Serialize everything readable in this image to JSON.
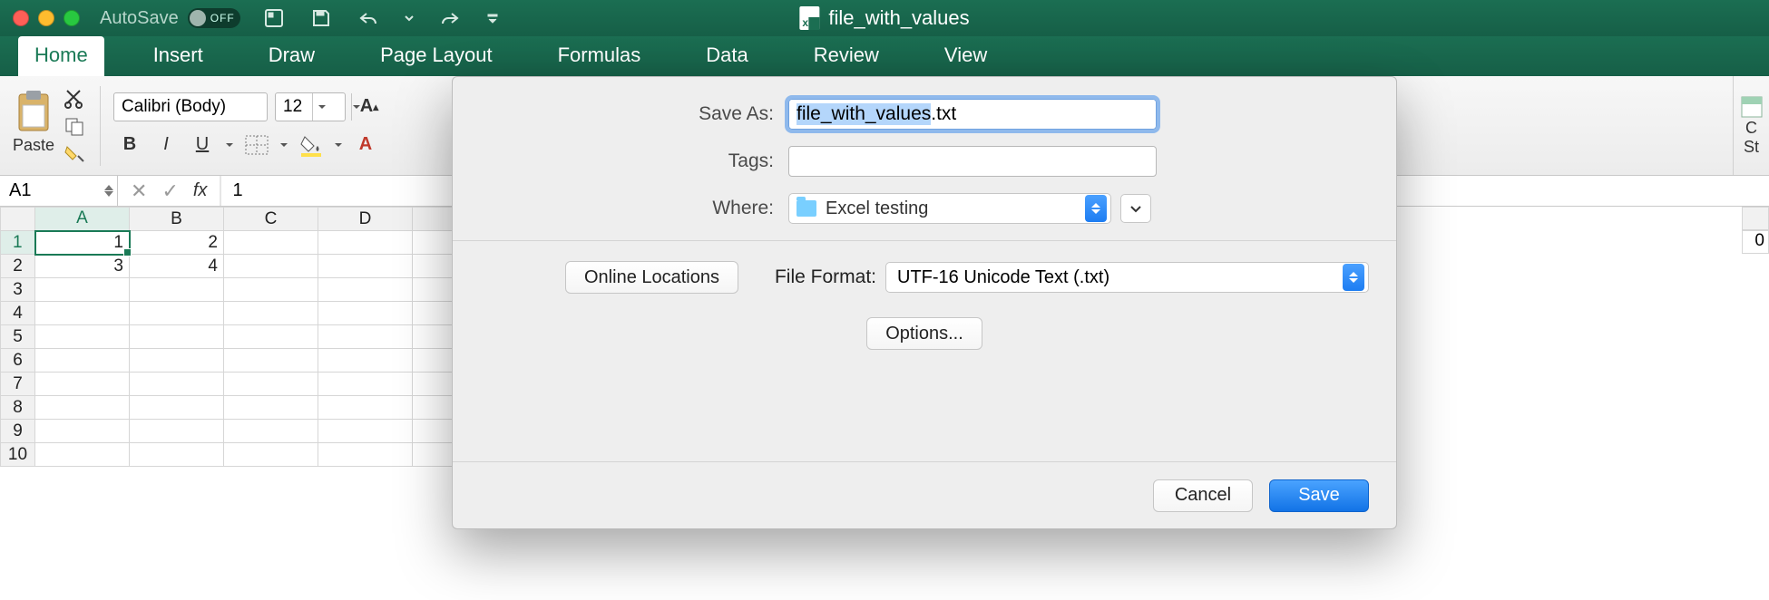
{
  "titlebar": {
    "autosave_label": "AutoSave",
    "autosave_state": "OFF",
    "document_name": "file_with_values"
  },
  "ribbon": {
    "tabs": [
      "Home",
      "Insert",
      "Draw",
      "Page Layout",
      "Formulas",
      "Data",
      "Review",
      "View"
    ],
    "active_tab": "Home",
    "paste_label": "Paste",
    "font_name": "Calibri (Body)",
    "font_size": "12",
    "right_clip_label1": "C",
    "right_clip_label2": "St"
  },
  "formula_bar": {
    "name_box": "A1",
    "fx_label": "fx",
    "value": "1"
  },
  "sheet": {
    "columns": [
      "A",
      "B",
      "C",
      "D"
    ],
    "row_count": 10,
    "active_cell": "A1",
    "cells": {
      "A1": "1",
      "B1": "2",
      "A2": "3",
      "B2": "4"
    }
  },
  "save_dialog": {
    "save_as_label": "Save As:",
    "filename_base": "file_with_values",
    "filename_ext": ".txt",
    "tags_label": "Tags:",
    "tags_value": "",
    "where_label": "Where:",
    "where_value": "Excel testing",
    "online_locations": "Online Locations",
    "file_format_label": "File Format:",
    "file_format_value": "UTF-16 Unicode Text (.txt)",
    "options_label": "Options...",
    "cancel": "Cancel",
    "save": "Save"
  },
  "right_cell_value": "0"
}
